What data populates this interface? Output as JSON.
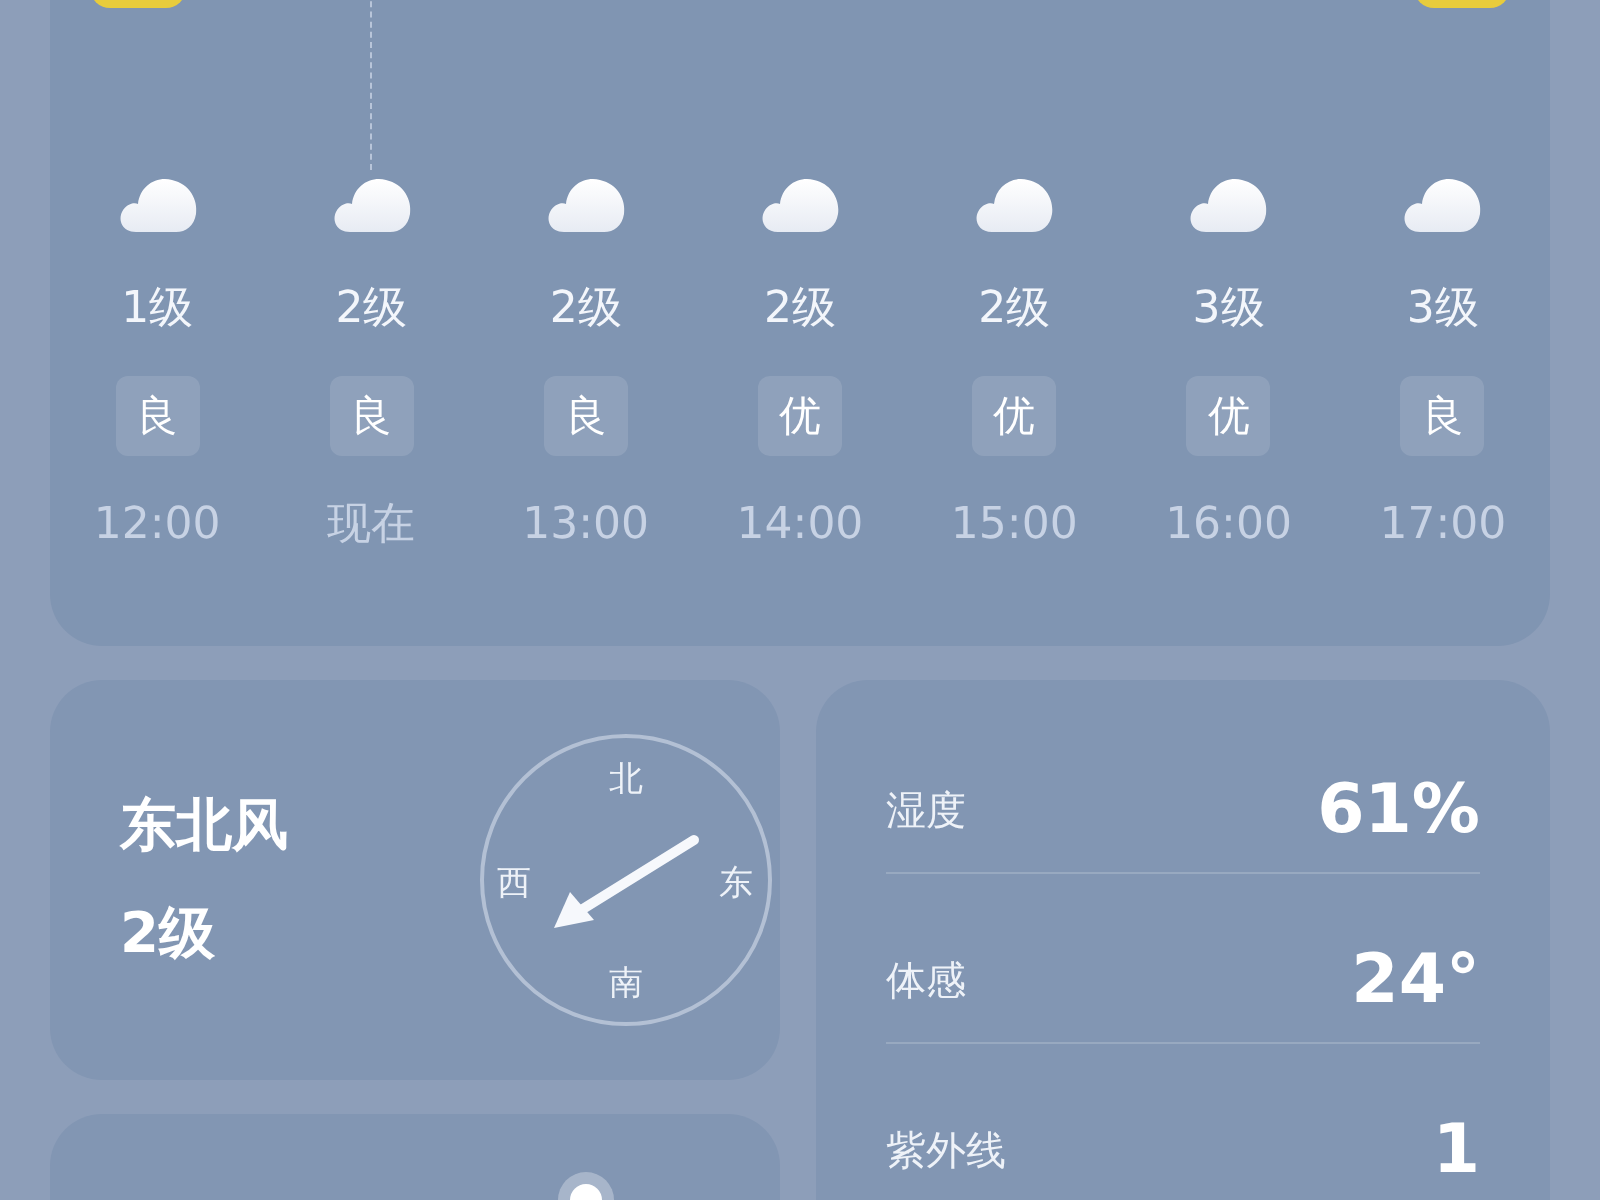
{
  "hourly": [
    {
      "wind": "1级",
      "aqi": "良",
      "time": "12:00",
      "current": false
    },
    {
      "wind": "2级",
      "aqi": "良",
      "time": "现在",
      "current": true
    },
    {
      "wind": "2级",
      "aqi": "良",
      "time": "13:00",
      "current": false
    },
    {
      "wind": "2级",
      "aqi": "优",
      "time": "14:00",
      "current": false
    },
    {
      "wind": "2级",
      "aqi": "优",
      "time": "15:00",
      "current": false
    },
    {
      "wind": "3级",
      "aqi": "优",
      "time": "16:00",
      "current": false
    },
    {
      "wind": "3级",
      "aqi": "良",
      "time": "17:00",
      "current": false
    }
  ],
  "wind_card": {
    "direction": "东北风",
    "level": "2级",
    "compass": {
      "north": "北",
      "south": "南",
      "west": "西",
      "east": "东"
    }
  },
  "details": [
    {
      "label": "湿度",
      "value": "61%"
    },
    {
      "label": "体感",
      "value": "24°"
    },
    {
      "label": "紫外线",
      "value": "1"
    }
  ]
}
